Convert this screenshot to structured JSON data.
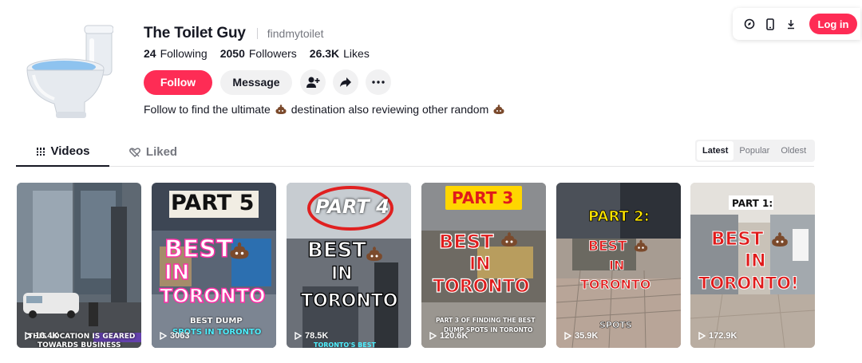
{
  "top_actions": {
    "login_label": "Log in",
    "icons": [
      "compass-icon",
      "phone-icon",
      "download-icon"
    ]
  },
  "profile": {
    "display_name": "The Toilet Guy",
    "username": "findmytoilet",
    "following_count": "24",
    "following_label": "Following",
    "followers_count": "2050",
    "followers_label": "Followers",
    "likes_count": "26.3K",
    "likes_label": "Likes",
    "follow_label": "Follow",
    "message_label": "Message",
    "bio_part1": "Follow to find the ultimate",
    "bio_part2": "destination also reviewing other random"
  },
  "tabs": {
    "videos": "Videos",
    "liked": "Liked"
  },
  "sort": {
    "options": [
      "Latest",
      "Popular",
      "Oldest"
    ],
    "selected": "Latest"
  },
  "videos": [
    {
      "views": "10.4K",
      "overlay": [
        "THIS LOCATION IS GEARED",
        "TOWARDS BUSINESS"
      ]
    },
    {
      "views": "3063",
      "top": "PART 5",
      "headline": [
        "BEST",
        "IN",
        "TORONTO"
      ],
      "bottom": [
        "BEST DUMP",
        "SPOTS IN TORONTO"
      ]
    },
    {
      "views": "78.5K",
      "top": "PART 4",
      "headline": [
        "BEST",
        "IN",
        "TORONTO"
      ],
      "bottom": [
        "TORONTO'S BEST"
      ]
    },
    {
      "views": "120.6K",
      "top": "PART 3",
      "headline": [
        "BEST",
        "IN",
        "TORONTO"
      ],
      "bottom": [
        "PART 3 OF FINDING THE BEST",
        "DUMP SPOTS IN TORONTO"
      ]
    },
    {
      "views": "35.9K",
      "top": "PART 2:",
      "headline": [
        "BEST",
        "IN",
        "TORONTO"
      ],
      "bottom": [
        "SPOTS"
      ]
    },
    {
      "views": "172.9K",
      "top": "PART 1:",
      "headline": [
        "BEST",
        "IN",
        "TORONTO!"
      ],
      "bottom": []
    }
  ],
  "colors": {
    "accent": "#fe2c55",
    "text": "#161823",
    "muted": "#75777f",
    "button_bg": "#f1f1f2"
  }
}
